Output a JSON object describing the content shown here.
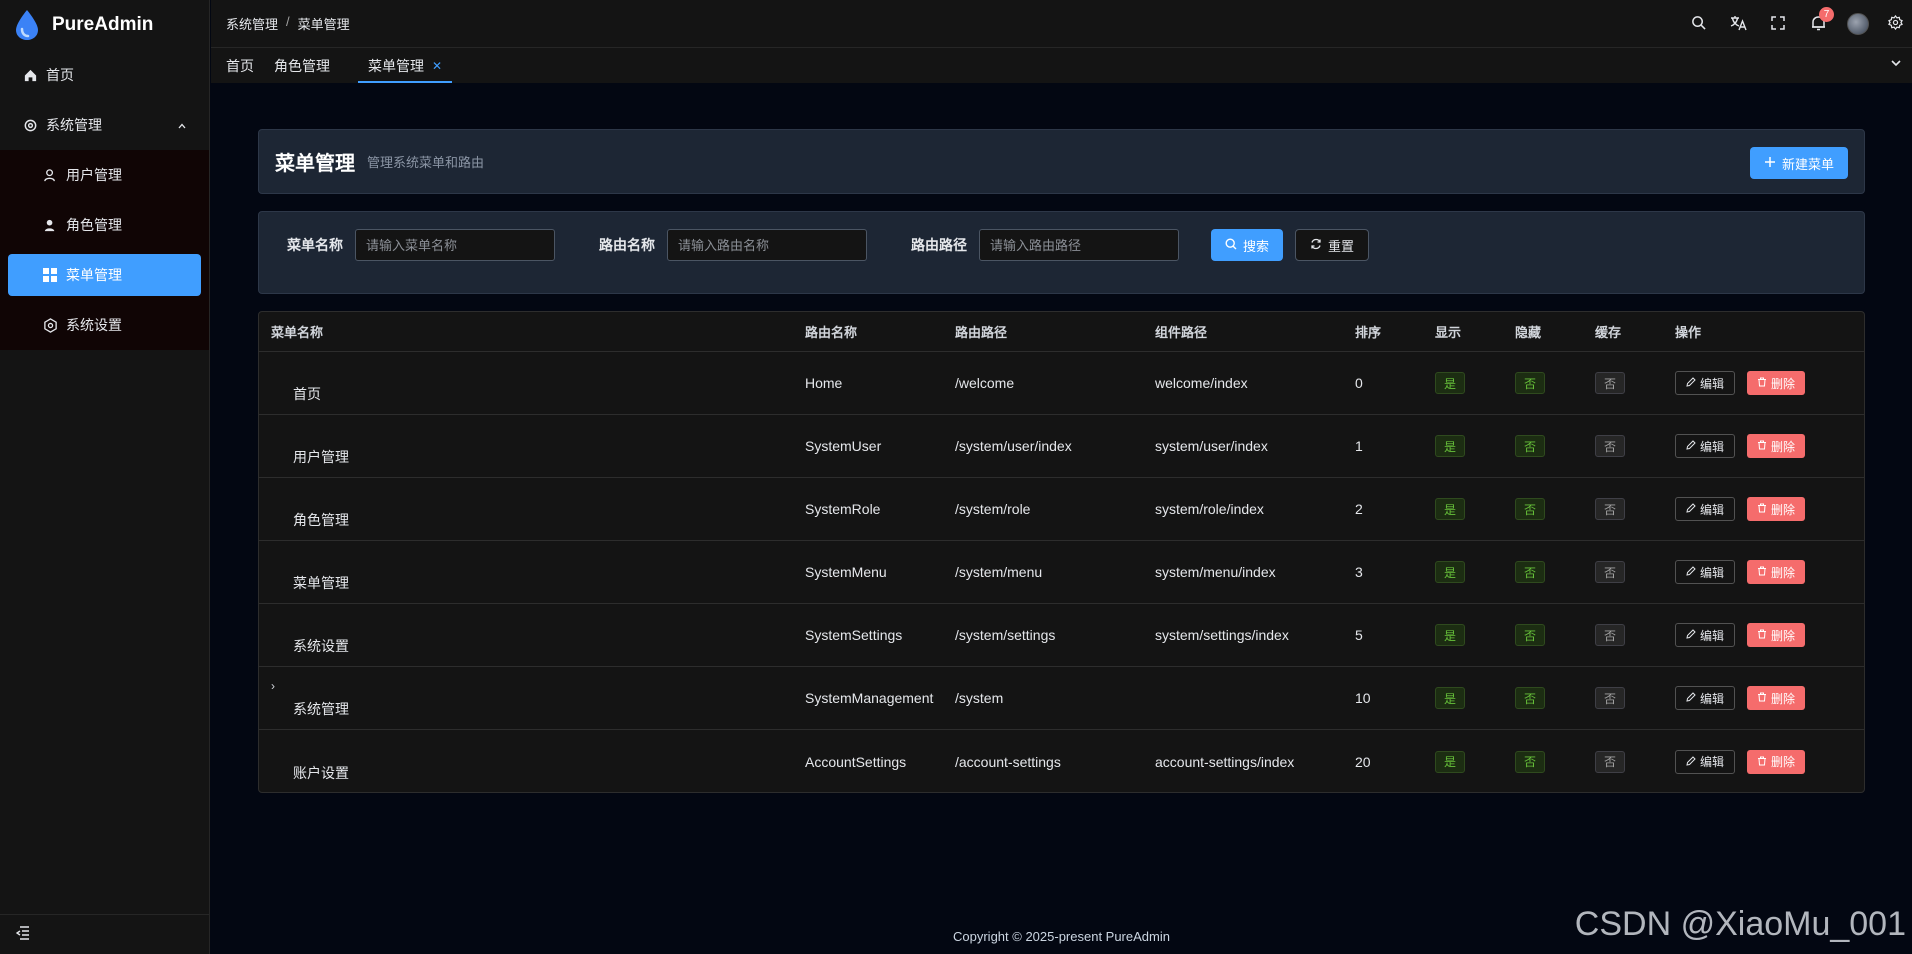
{
  "app": {
    "name": "PureAdmin"
  },
  "sidebar": {
    "items": [
      {
        "label": "首页",
        "icon": "home-icon"
      },
      {
        "label": "系统管理",
        "icon": "gear-icon"
      }
    ],
    "children": [
      {
        "label": "用户管理",
        "icon": "user-icon"
      },
      {
        "label": "角色管理",
        "icon": "role-icon"
      },
      {
        "label": "菜单管理",
        "icon": "grid-icon",
        "active": true
      },
      {
        "label": "系统设置",
        "icon": "settings-icon"
      }
    ]
  },
  "header": {
    "breadcrumb": [
      "系统管理",
      "菜单管理"
    ],
    "notification_count": "7"
  },
  "tags": [
    "首页",
    "角色管理",
    "菜单管理"
  ],
  "page": {
    "title": "菜单管理",
    "subtitle": "管理系统菜单和路由",
    "new_button": "新建菜单"
  },
  "filters": {
    "menu_name_label": "菜单名称",
    "menu_name_placeholder": "请输入菜单名称",
    "route_name_label": "路由名称",
    "route_name_placeholder": "请输入路由名称",
    "route_path_label": "路由路径",
    "route_path_placeholder": "请输入路由路径",
    "search_button": "搜索",
    "reset_button": "重置"
  },
  "table": {
    "columns": [
      "菜单名称",
      "路由名称",
      "路由路径",
      "组件路径",
      "排序",
      "显示",
      "隐藏",
      "缓存",
      "操作"
    ],
    "edit_label": "编辑",
    "delete_label": "删除",
    "rows": [
      {
        "name": "首页",
        "route_name": "Home",
        "path": "/welcome",
        "component": "welcome/index",
        "order": "0",
        "show": "是",
        "hidden": "否",
        "cache": "否"
      },
      {
        "name": "用户管理",
        "route_name": "SystemUser",
        "path": "/system/user/index",
        "component": "system/user/index",
        "order": "1",
        "show": "是",
        "hidden": "否",
        "cache": "否"
      },
      {
        "name": "角色管理",
        "route_name": "SystemRole",
        "path": "/system/role",
        "component": "system/role/index",
        "order": "2",
        "show": "是",
        "hidden": "否",
        "cache": "否"
      },
      {
        "name": "菜单管理",
        "route_name": "SystemMenu",
        "path": "/system/menu",
        "component": "system/menu/index",
        "order": "3",
        "show": "是",
        "hidden": "否",
        "cache": "否"
      },
      {
        "name": "系统设置",
        "route_name": "SystemSettings",
        "path": "/system/settings",
        "component": "system/settings/index",
        "order": "5",
        "show": "是",
        "hidden": "否",
        "cache": "否"
      },
      {
        "name": "系统管理",
        "route_name": "SystemManagement",
        "path": "/system",
        "component": "",
        "order": "10",
        "show": "是",
        "hidden": "否",
        "cache": "否",
        "expandable": true
      },
      {
        "name": "账户设置",
        "route_name": "AccountSettings",
        "path": "/account-settings",
        "component": "account-settings/index",
        "order": "20",
        "show": "是",
        "hidden": "否",
        "cache": "否"
      }
    ]
  },
  "footer": {
    "copyright": "Copyright © 2025-present PureAdmin"
  },
  "watermark": "CSDN @XiaoMu_001",
  "colors": {
    "primary": "#409eff",
    "danger": "#f56c6c",
    "success": "#67c23a"
  }
}
